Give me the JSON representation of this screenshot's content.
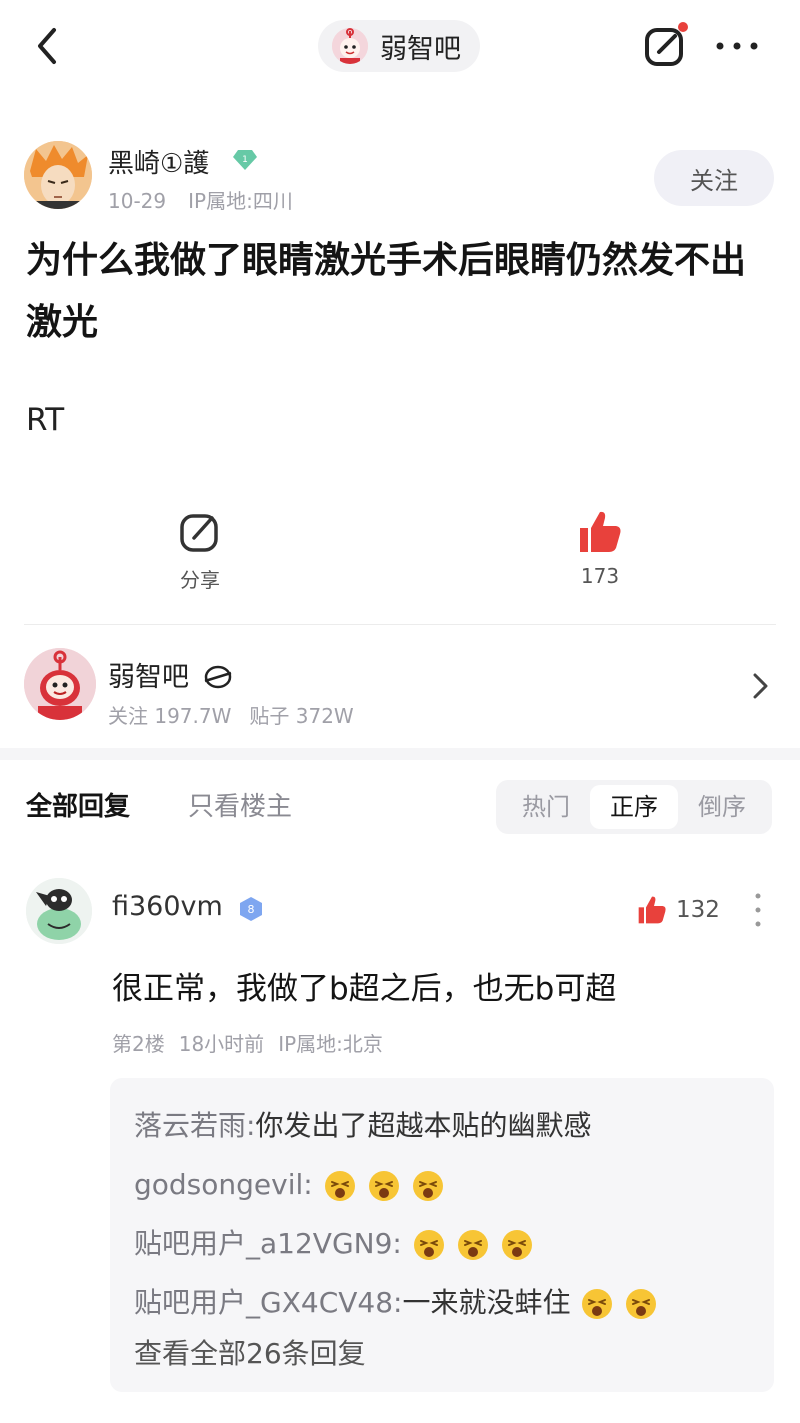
{
  "header": {
    "forum_pill_label": "弱智吧"
  },
  "post": {
    "author_name": "黑崎①護",
    "author_level": "1",
    "date": "10-29",
    "ip": "IP属地:四川",
    "follow_label": "关注",
    "title": "为什么我做了眼睛激光手术后眼睛仍然发不出激光",
    "body": "RT",
    "share_label": "分享",
    "like_count": "173"
  },
  "forum": {
    "name": "弱智吧",
    "followers": "关注 197.7W",
    "posts": "贴子 372W"
  },
  "reply_tabs": {
    "all": "全部回复",
    "op_only": "只看楼主",
    "sort_options": [
      "热门",
      "正序",
      "倒序"
    ],
    "active_sort": "正序"
  },
  "reply": {
    "user": "fi360vm",
    "badge_level": "8",
    "like_count": "132",
    "text": "很正常，我做了b超之后，也无b可超",
    "floor": "第2楼",
    "time": "18小时前",
    "ip": "IP属地:北京",
    "sub_replies": [
      {
        "user": "落云若雨:",
        "text": "你发出了超越本贴的幽默感",
        "emoji_count": 0
      },
      {
        "user": "godsongevil:",
        "text": "",
        "emoji_count": 3
      },
      {
        "user": "贴吧用户_a12VGN9:",
        "text": "",
        "emoji_count": 3
      },
      {
        "user": "贴吧用户_GX4CV48:",
        "text": "一来就没蚌住",
        "emoji_count": 2
      }
    ],
    "view_all": "查看全部26条回复"
  },
  "icons": {
    "back": "chevron-left-icon",
    "edit": "edit-icon",
    "more": "more-icon",
    "share": "share-icon",
    "like": "thumb-up-icon",
    "emoji": "laughing-emoji-icon"
  },
  "colors": {
    "like_red": "#e8413c",
    "meta_gray": "#a0a0a8",
    "badge_green": "#66c9a6",
    "badge_blue": "#7ea6f0"
  }
}
